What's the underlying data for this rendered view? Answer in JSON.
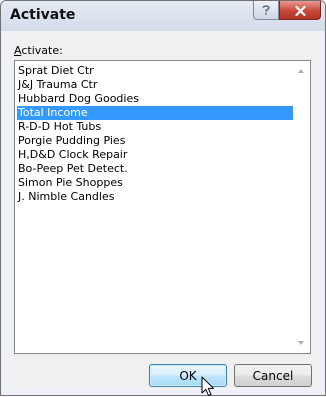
{
  "dialog": {
    "title": "Activate",
    "label_prefix": "",
    "label_access_key": "A",
    "label_rest": "ctivate:"
  },
  "sheets": [
    "Sprat Diet Ctr",
    "J&J Trauma Ctr",
    "Hubbard Dog Goodies",
    "Total Income",
    "R-D-D Hot Tubs",
    "Porgie Pudding Pies",
    "H,D&D Clock Repair",
    "Bo-Peep Pet Detect.",
    "Simon Pie Shoppes",
    "J. Nimble Candles"
  ],
  "selected_sheet": "Total Income",
  "buttons": {
    "ok_label": "OK",
    "cancel_label": "Cancel"
  },
  "icons": {
    "help": "help-icon",
    "close": "close-icon",
    "cursor": "mouse-pointer-icon"
  },
  "colors": {
    "selection": "#3399ff",
    "close_button": "#c8473a"
  }
}
